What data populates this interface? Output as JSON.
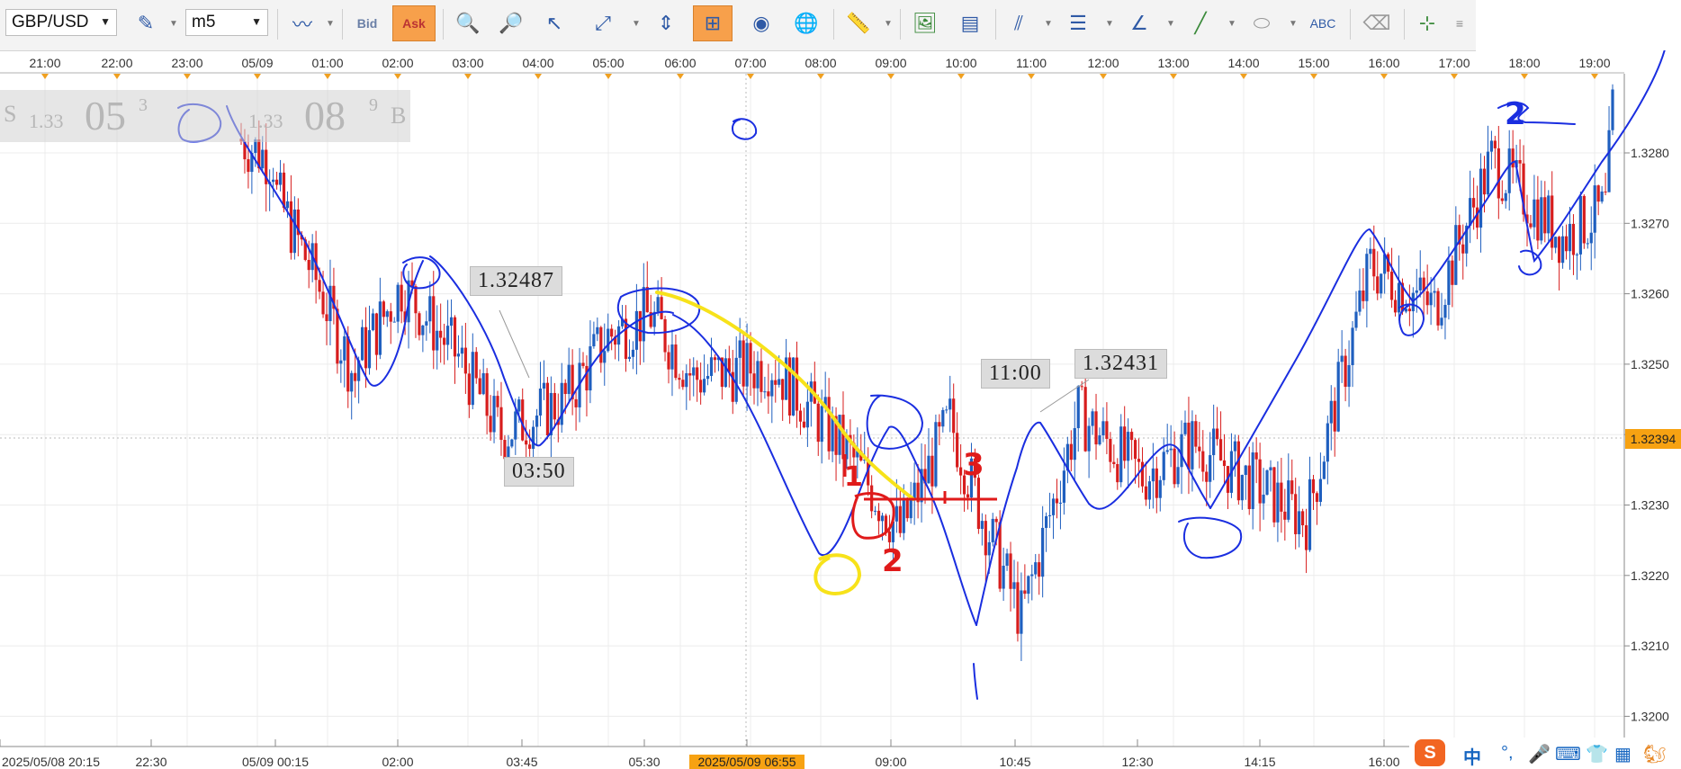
{
  "toolbar": {
    "symbol": "GBP/USD",
    "timeframe": "m5",
    "bid_label": "Bid",
    "ask_label": "Ask"
  },
  "quote_panel": {
    "sell_label": "S",
    "sell_big": "1.33",
    "sell_main": "05",
    "sell_small": "3",
    "buy_big": "1.33",
    "buy_main": "08",
    "buy_small": "9",
    "buy_label": "B"
  },
  "top_axis": [
    "21:00",
    "22:00",
    "23:00",
    "05/09",
    "01:00",
    "02:00",
    "03:00",
    "04:00",
    "05:00",
    "06:00",
    "07:00",
    "08:00",
    "09:00",
    "10:00",
    "11:00",
    "12:00",
    "13:00",
    "14:00",
    "15:00",
    "16:00",
    "17:00",
    "18:00",
    "19:00"
  ],
  "bottom_axis": [
    "2025/05/08 20:15",
    "22:30",
    "05/09 00:15",
    "02:00",
    "03:45",
    "05:30",
    "2025/05/09 06:55",
    "09:00",
    "10:45",
    "12:30",
    "14:15",
    "16:00"
  ],
  "price_axis": [
    "1.3280",
    "1.3270",
    "1.3260",
    "1.3250",
    "1.3240",
    "1.3230",
    "1.3220",
    "1.3210",
    "1.3200"
  ],
  "current_price": "1.32394",
  "annotations": {
    "label_1": "1.32487",
    "label_2": "03:50",
    "label_3": "11:00",
    "label_4": "1.32431"
  },
  "handwriting": {
    "mark_1": "1",
    "mark_2": "2",
    "mark_3": "3",
    "mark_4": "2"
  },
  "ime_bar": {
    "logo": "S",
    "lang": "中",
    "punct": "°,"
  },
  "chart_data": {
    "type": "candlestick",
    "symbol": "GBP/USD",
    "timeframe": "m5",
    "ylim": [
      1.3195,
      1.33
    ],
    "path_hint": [
      [
        0,
        1.3282,
        1.3279
      ],
      [
        10,
        1.3275,
        1.3262
      ],
      [
        22,
        1.3262,
        1.3248
      ],
      [
        33,
        1.325,
        1.3261
      ],
      [
        46,
        1.3261,
        1.3251
      ],
      [
        62,
        1.3251,
        1.324
      ],
      [
        74,
        1.324,
        1.3245
      ],
      [
        92,
        1.3245,
        1.3254
      ],
      [
        104,
        1.3254,
        1.3257
      ],
      [
        116,
        1.3257,
        1.3248
      ],
      [
        128,
        1.3248,
        1.325
      ],
      [
        150,
        1.325,
        1.3237
      ],
      [
        172,
        1.3237,
        1.3226
      ],
      [
        186,
        1.3226,
        1.3242
      ],
      [
        200,
        1.3242,
        1.323
      ],
      [
        208,
        1.323,
        1.3214
      ],
      [
        220,
        1.3214,
        1.3243
      ],
      [
        236,
        1.3243,
        1.3234
      ],
      [
        254,
        1.3234,
        1.3239
      ],
      [
        268,
        1.3239,
        1.3228
      ],
      [
        300,
        1.3228,
        1.3264
      ],
      [
        318,
        1.3264,
        1.3258
      ],
      [
        336,
        1.3258,
        1.3279
      ],
      [
        352,
        1.3279,
        1.3268
      ],
      [
        372,
        1.3268,
        1.3272
      ],
      [
        384,
        1.3272,
        1.3286
      ]
    ]
  }
}
